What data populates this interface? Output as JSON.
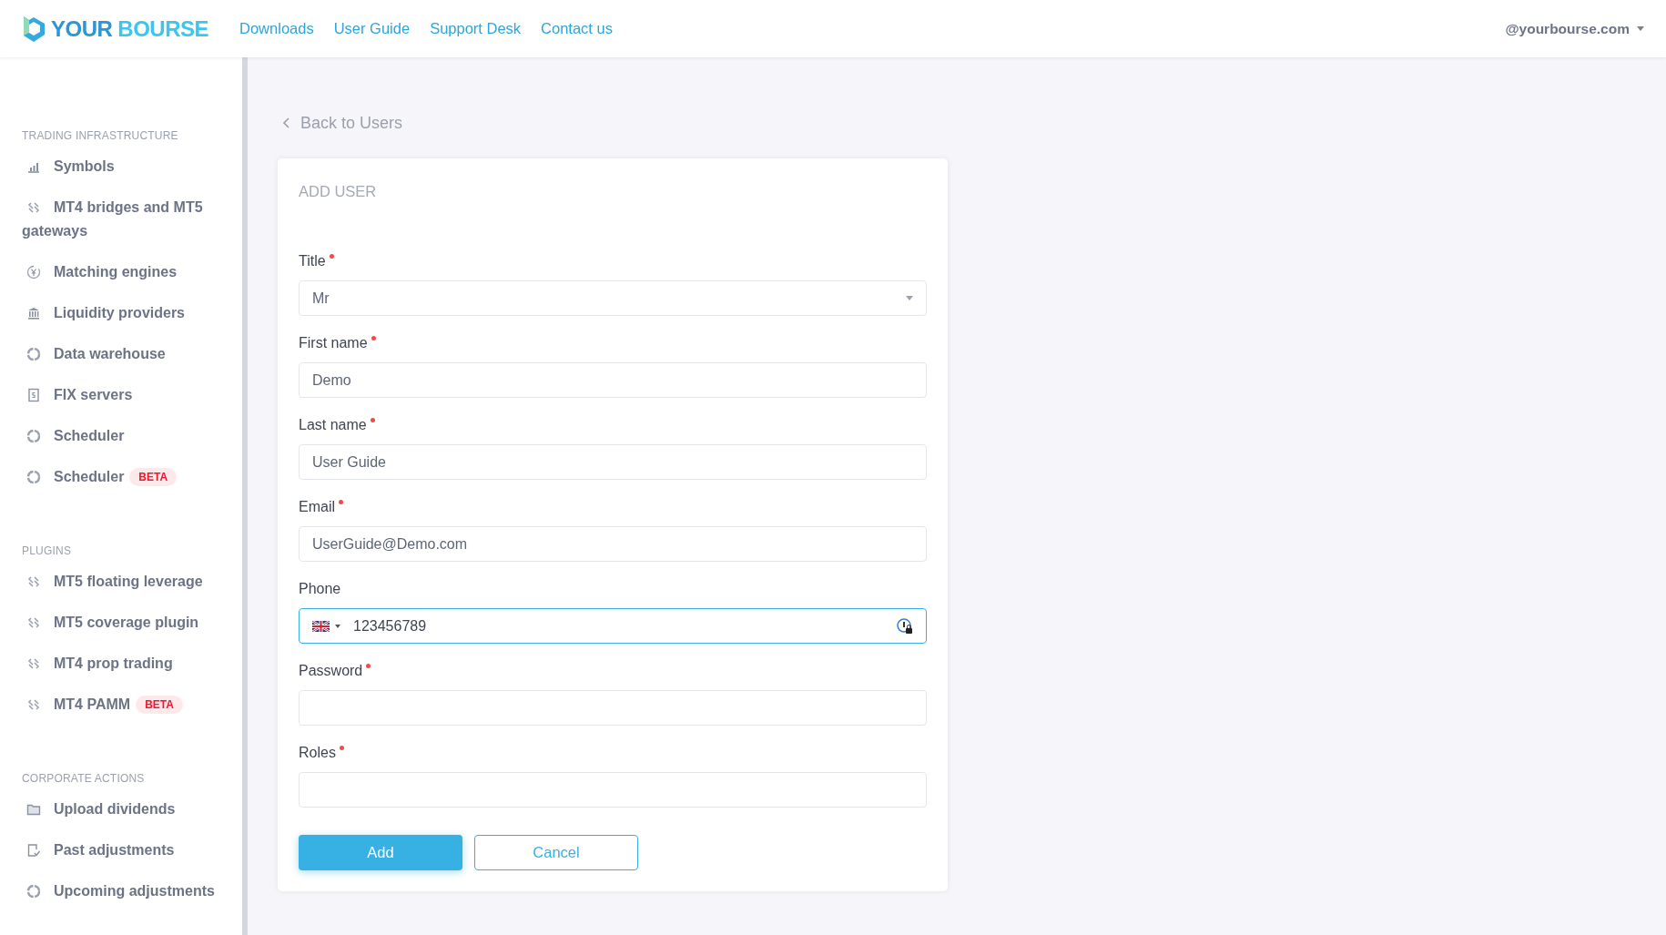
{
  "header": {
    "logo": {
      "word_1": "YOUR",
      "word_2": "BOURSE"
    },
    "nav": [
      "Downloads",
      "User Guide",
      "Support Desk",
      "Contact us"
    ],
    "account": "@yourbourse.com"
  },
  "sidebar": {
    "sections": [
      {
        "heading": "TRADING INFRASTRUCTURE",
        "items": [
          {
            "label": "Symbols",
            "kind": "bars"
          },
          {
            "label": "MT4 bridges and MT5 gateways",
            "kind": "link"
          },
          {
            "label": "Matching engines",
            "kind": "yen"
          },
          {
            "label": "Liquidity providers",
            "kind": "bank"
          },
          {
            "label": "Data warehouse",
            "kind": "ring"
          },
          {
            "label": "FIX servers",
            "kind": "doc"
          },
          {
            "label": "Scheduler",
            "kind": "ring"
          },
          {
            "label": "Scheduler",
            "kind": "ring",
            "badge": "BETA"
          }
        ]
      },
      {
        "heading": "PLUGINS",
        "items": [
          {
            "label": "MT5 floating leverage",
            "kind": "link"
          },
          {
            "label": "MT5 coverage plugin",
            "kind": "link"
          },
          {
            "label": "MT4 prop trading",
            "kind": "link"
          },
          {
            "label": "MT4 PAMM",
            "kind": "link",
            "badge": "BETA"
          }
        ]
      },
      {
        "heading": "CORPORATE ACTIONS",
        "items": [
          {
            "label": "Upload dividends",
            "kind": "folder"
          },
          {
            "label": "Past adjustments",
            "kind": "checkdoc"
          },
          {
            "label": "Upcoming adjustments",
            "kind": "ring"
          }
        ]
      }
    ]
  },
  "back_link": "Back to Users",
  "form": {
    "title": "ADD USER",
    "fields": [
      {
        "kind": "select",
        "label": "Title",
        "required": true,
        "value": "Mr"
      },
      {
        "kind": "text",
        "label": "First name",
        "required": true,
        "value": "Demo"
      },
      {
        "kind": "text",
        "label": "Last name",
        "required": true,
        "value": "User Guide"
      },
      {
        "kind": "text",
        "label": "Email",
        "required": true,
        "value": "UserGuide@Demo.com"
      },
      {
        "kind": "phone",
        "label": "Phone",
        "required": false,
        "value": "123456789",
        "focused": true
      },
      {
        "kind": "text",
        "label": "Password",
        "required": true
      },
      {
        "kind": "text",
        "label": "Roles",
        "required": true
      }
    ],
    "buttons": [
      {
        "kind": "primary",
        "label": "Add"
      },
      {
        "kind": "outline",
        "label": "Cancel"
      }
    ]
  }
}
